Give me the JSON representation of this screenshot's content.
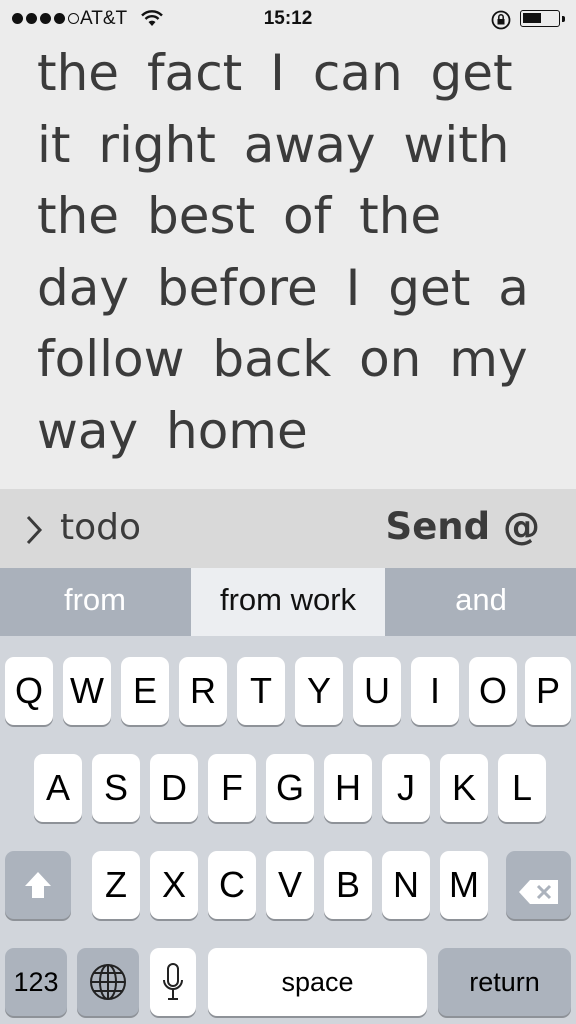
{
  "status_bar": {
    "carrier": "AT&T",
    "time": "15:12",
    "signal_bars": 4,
    "battery_level": 0.5
  },
  "note": {
    "text": "the fact I can get it right away with the best of the day before I get a follow back on my way home"
  },
  "action_bar": {
    "list_name": "todo",
    "send_label": "Send @"
  },
  "suggestions": {
    "items": [
      "from",
      "from work",
      "and"
    ],
    "selected_index": 1
  },
  "keyboard": {
    "row1": [
      "Q",
      "W",
      "E",
      "R",
      "T",
      "Y",
      "U",
      "I",
      "O",
      "P"
    ],
    "row2": [
      "A",
      "S",
      "D",
      "F",
      "G",
      "H",
      "J",
      "K",
      "L"
    ],
    "row3": [
      "Z",
      "X",
      "C",
      "V",
      "B",
      "N",
      "M"
    ],
    "numbers_label": "123",
    "space_label": "space",
    "return_label": "return"
  },
  "icons": {
    "shift": "shift-icon",
    "backspace": "backspace-icon",
    "globe": "globe-icon",
    "mic": "microphone-icon",
    "chevron": "chevron-right-icon"
  }
}
